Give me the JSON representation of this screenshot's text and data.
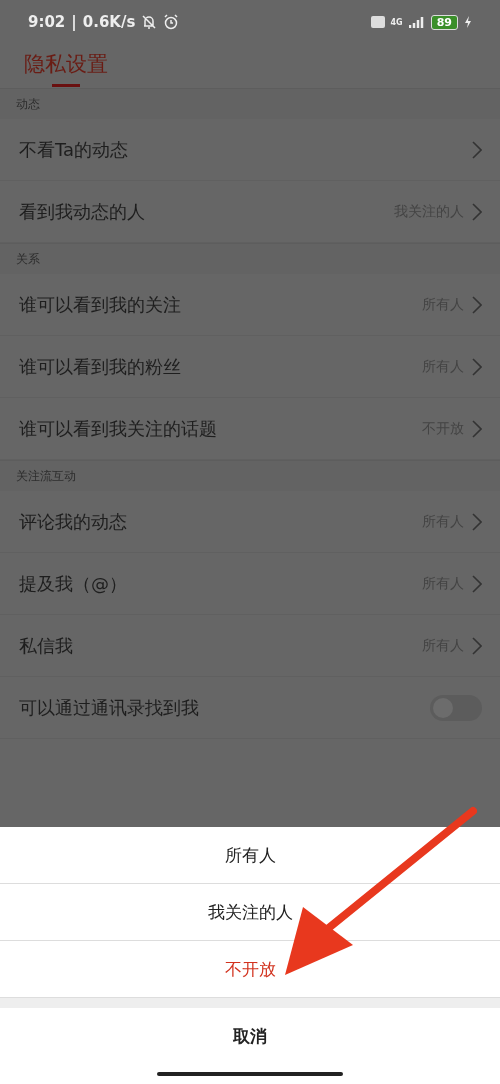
{
  "status_bar": {
    "time": "9:02",
    "separator": "|",
    "speed": "0.6K/s",
    "network": "4G",
    "battery": "89"
  },
  "header": {
    "title": "隐私设置"
  },
  "sections": [
    {
      "title": "动态",
      "rows": [
        {
          "kind": "link",
          "label": "不看Ta的动态"
        },
        {
          "kind": "link",
          "label": "看到我动态的人",
          "value": "我关注的人"
        }
      ]
    },
    {
      "title": "关系",
      "rows": [
        {
          "kind": "link",
          "label": "谁可以看到我的关注",
          "value": "所有人"
        },
        {
          "kind": "link",
          "label": "谁可以看到我的粉丝",
          "value": "所有人"
        },
        {
          "kind": "link",
          "label": "谁可以看到我关注的话题",
          "value": "不开放"
        }
      ]
    },
    {
      "title": "关注流互动",
      "rows": [
        {
          "kind": "link",
          "label": "评论我的动态",
          "value": "所有人"
        },
        {
          "kind": "link",
          "label": "提及我（@）",
          "value": "所有人"
        },
        {
          "kind": "link",
          "label": "私信我",
          "value": "所有人"
        },
        {
          "kind": "toggle",
          "label": "可以通过通讯录找到我",
          "on": false
        }
      ]
    }
  ],
  "sheet": {
    "options": [
      {
        "label": "所有人",
        "selected": false
      },
      {
        "label": "我关注的人",
        "selected": false
      },
      {
        "label": "不开放",
        "selected": true
      }
    ],
    "cancel": "取消"
  }
}
